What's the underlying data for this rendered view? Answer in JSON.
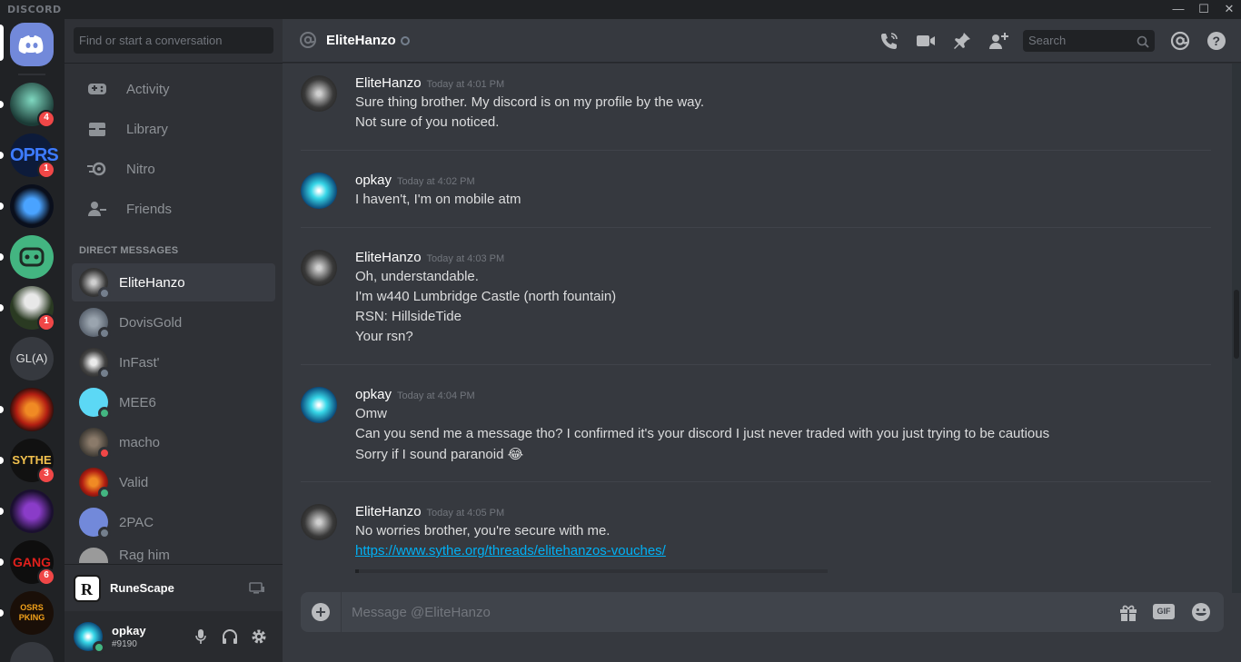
{
  "app": {
    "brand": "DISCORD"
  },
  "window_controls": {
    "minimize": "—",
    "maximize": "☐",
    "close": "✕"
  },
  "servers": [
    {
      "name": "home",
      "badge": ""
    },
    {
      "name": "server-2",
      "badge": "4"
    },
    {
      "name": "server-oprs",
      "label": "OPRS",
      "badge": "1"
    },
    {
      "name": "server-4",
      "badge": ""
    },
    {
      "name": "server-5",
      "badge": ""
    },
    {
      "name": "server-panda",
      "badge": "1"
    },
    {
      "name": "server-gla",
      "label": "GL(A)",
      "badge": ""
    },
    {
      "name": "server-phoenix",
      "badge": ""
    },
    {
      "name": "server-sythe",
      "label": "SYTHE",
      "badge": "3"
    },
    {
      "name": "server-skull",
      "badge": ""
    },
    {
      "name": "server-gang",
      "label": "GANG",
      "badge": "6"
    },
    {
      "name": "server-osrs",
      "label": "OSRS PKING",
      "badge": ""
    }
  ],
  "search": {
    "placeholder": "Find or start a conversation"
  },
  "nav": {
    "activity": "Activity",
    "library": "Library",
    "nitro": "Nitro",
    "friends": "Friends"
  },
  "dm_header": "DIRECT MESSAGES",
  "dms": [
    {
      "name": "EliteHanzo",
      "status": "offline",
      "active": true
    },
    {
      "name": "DovisGold",
      "status": "offline"
    },
    {
      "name": "InFast'",
      "status": "offline"
    },
    {
      "name": "MEE6",
      "status": "online"
    },
    {
      "name": "macho",
      "status": "dnd"
    },
    {
      "name": "Valid",
      "status": "online"
    },
    {
      "name": "2PAC",
      "status": "offline"
    },
    {
      "name": "Rag him",
      "status": "offline"
    }
  ],
  "activity": {
    "game": "RuneScape"
  },
  "user": {
    "name": "opkay",
    "tag": "#9190"
  },
  "chat_header": {
    "name": "EliteHanzo",
    "search_placeholder": "Search"
  },
  "messages": [
    {
      "author": "EliteHanzo",
      "time": "Today at 4:01 PM",
      "lines": [
        "Sure thing brother. My discord is on my profile by the way.",
        "Not sure of you noticed."
      ]
    },
    {
      "author": "opkay",
      "time": "Today at 4:02 PM",
      "lines": [
        "I haven't, I'm on mobile atm"
      ]
    },
    {
      "author": "EliteHanzo",
      "time": "Today at 4:03 PM",
      "lines": [
        "Oh, understandable.",
        "I'm w440 Lumbridge Castle (north fountain)",
        "RSN: HillsideTide",
        "Your rsn?"
      ]
    },
    {
      "author": "opkay",
      "time": "Today at 4:04 PM",
      "lines": [
        "Omw",
        "Can you send me a message tho? I confirmed it's your discord I just never traded with you just trying to be cautious",
        "Sorry if I sound paranoid 😂"
      ]
    },
    {
      "author": "EliteHanzo",
      "time": "Today at 4:05 PM",
      "lines": [
        "No worries brother, you're secure with me."
      ],
      "link": "https://www.sythe.org/threads/elitehanzos-vouches/"
    }
  ],
  "composer": {
    "placeholder": "Message @EliteHanzo"
  },
  "colors": {
    "blurple": "#7289da",
    "online": "#43b581",
    "dnd": "#f04747",
    "offline": "#747f8d",
    "link": "#00b0f4"
  }
}
